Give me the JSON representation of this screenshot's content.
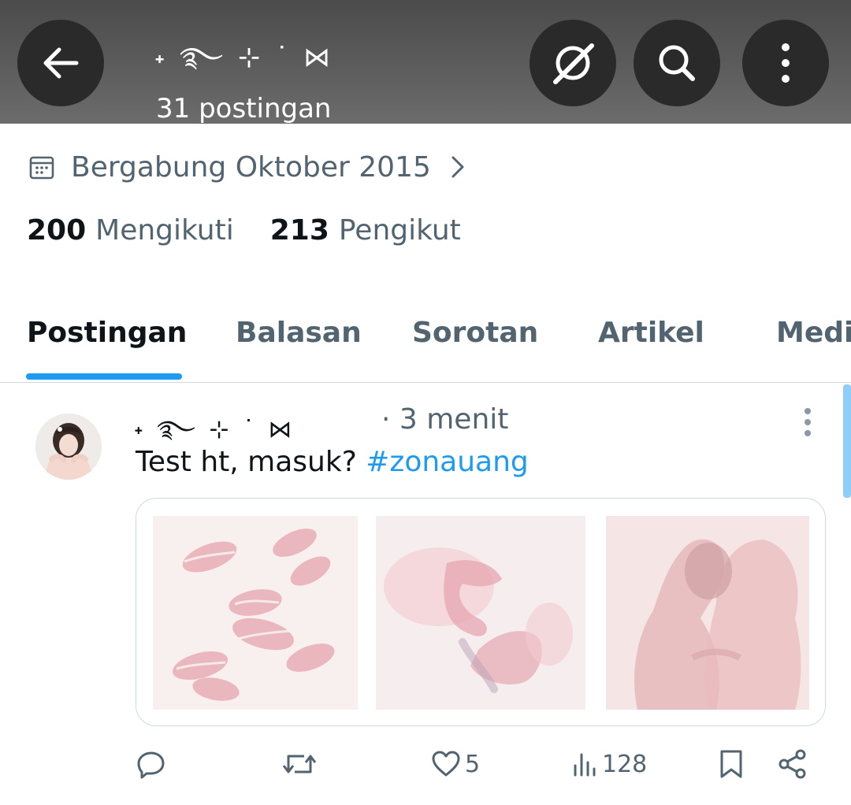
{
  "header": {
    "display_name": "˖ ࿐ ⊹ ˙ ⋈",
    "post_count": "31 postingan"
  },
  "profile": {
    "joined": "Bergabung Oktober 2015",
    "following_count": "200",
    "following_label": "Mengikuti",
    "followers_count": "213",
    "followers_label": "Pengikut"
  },
  "tabs": [
    {
      "label": "Postingan",
      "active": true
    },
    {
      "label": "Balasan",
      "active": false
    },
    {
      "label": "Sorotan",
      "active": false
    },
    {
      "label": "Artikel",
      "active": false
    },
    {
      "label": "Media",
      "active": false
    }
  ],
  "post": {
    "author": "˖ ࿐ ⊹ ˙ ⋈",
    "time": "· 3 menit",
    "text": "Test ht, masuk? ",
    "hashtag": "#zonauang",
    "likes": "5",
    "views": "128"
  },
  "colors": {
    "accent": "#1d9bf0",
    "secondary_text": "#536471",
    "primary_text": "#0f1419"
  }
}
